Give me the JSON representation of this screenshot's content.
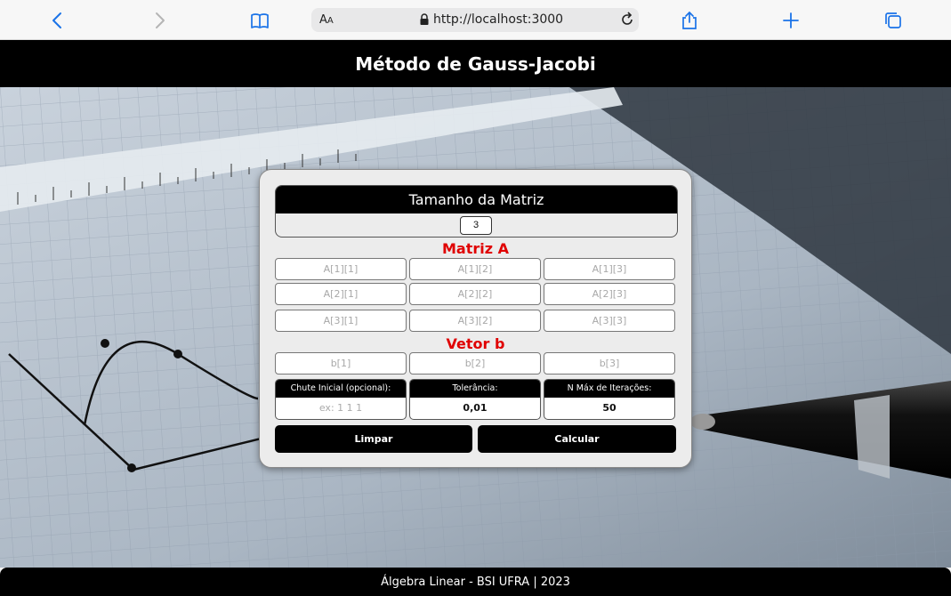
{
  "browser": {
    "text_size_label": "AA",
    "url": "http://localhost:3000"
  },
  "header": {
    "title": "Método de Gauss-Jacobi"
  },
  "matrix_size": {
    "title": "Tamanho da Matriz",
    "value": "3"
  },
  "matrix_a": {
    "title": "Matriz A",
    "cells": [
      [
        "A[1][1]",
        "A[1][2]",
        "A[1][3]"
      ],
      [
        "A[2][1]",
        "A[2][2]",
        "A[2][3]"
      ],
      [
        "A[3][1]",
        "A[3][2]",
        "A[3][3]"
      ]
    ]
  },
  "vector_b": {
    "title": "Vetor b",
    "cells": [
      "b[1]",
      "b[2]",
      "b[3]"
    ]
  },
  "params": {
    "initial_guess": {
      "label": "Chute Inicial (opcional):",
      "placeholder": "ex: 1 1 1"
    },
    "tolerance": {
      "label": "Tolerância:",
      "value": "0,01"
    },
    "max_iterations": {
      "label": "N Máx de Iterações:",
      "value": "50"
    }
  },
  "buttons": {
    "clear": "Limpar",
    "calculate": "Calcular"
  },
  "footer": {
    "text": "Álgebra Linear - BSI UFRA | 2023"
  },
  "colors": {
    "accent_red": "#e00000",
    "header_bg": "#000000",
    "browser_blue": "#1a73e8"
  }
}
